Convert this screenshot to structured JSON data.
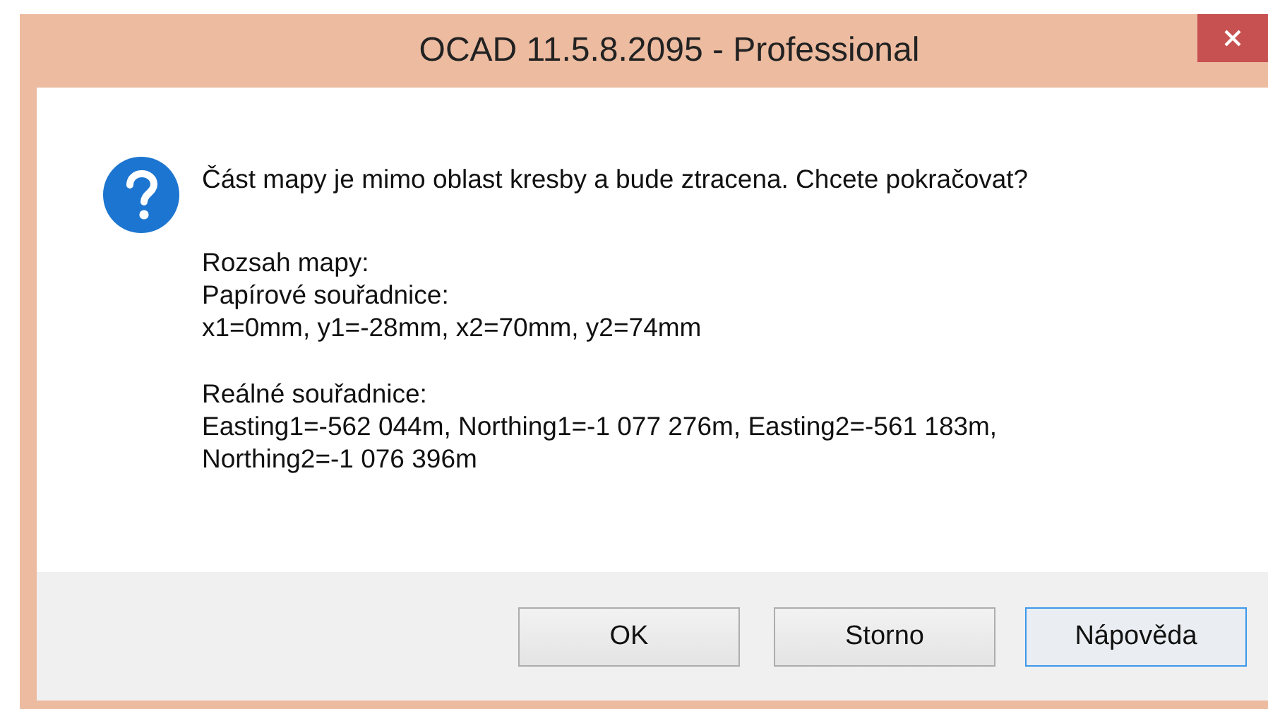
{
  "window": {
    "title": "OCAD 11.5.8.2095 - Professional"
  },
  "message": "Část mapy je mimo oblast kresby a bude ztracena. Chcete pokračovat?",
  "details": [
    [
      "Rozsah mapy:",
      "Papírové souřadnice:",
      "x1=0mm, y1=-28mm, x2=70mm, y2=74mm"
    ],
    [
      "Reálné souřadnice:",
      "Easting1=-562 044m, Northing1=-1 077 276m, Easting2=-561 183m,",
      "Northing2=-1 076 396m"
    ]
  ],
  "buttons": [
    {
      "label": "OK",
      "focused": false
    },
    {
      "label": "Storno",
      "focused": false
    },
    {
      "label": "Nápověda",
      "focused": true
    }
  ]
}
